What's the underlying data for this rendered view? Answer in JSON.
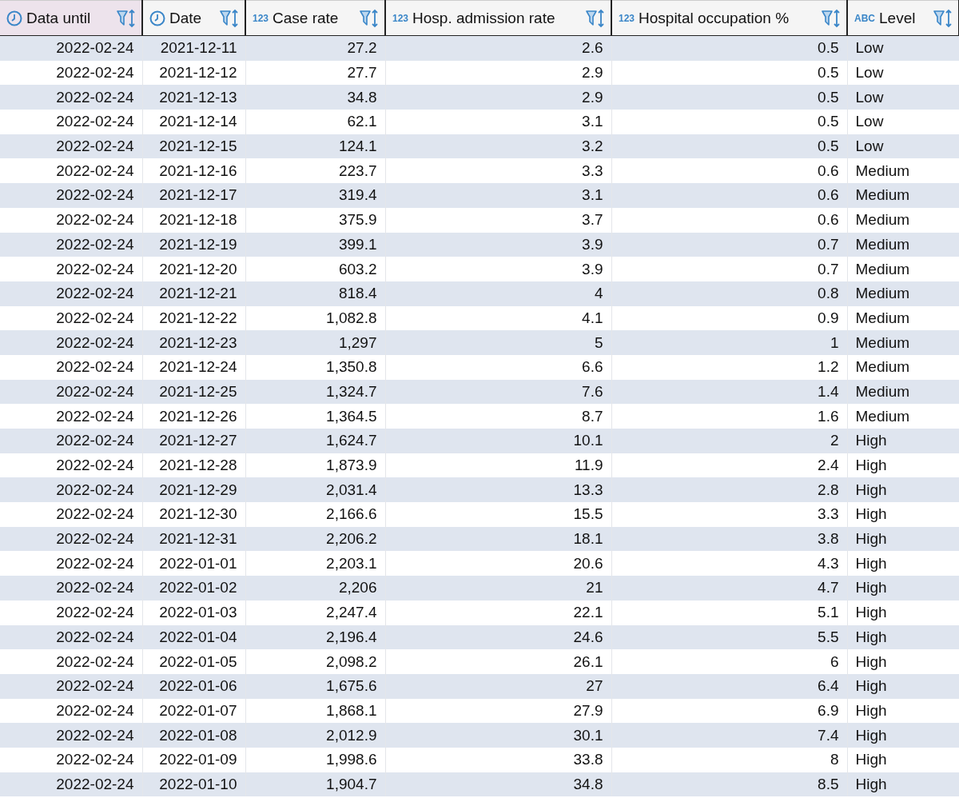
{
  "table": {
    "columns": [
      {
        "label": "Data until",
        "kind": "date",
        "selected": true
      },
      {
        "label": "Date",
        "kind": "date",
        "selected": false
      },
      {
        "label": "Case rate",
        "kind": "number",
        "badge": "123",
        "selected": false
      },
      {
        "label": "Hosp. admission rate",
        "kind": "number",
        "badge": "123",
        "selected": false
      },
      {
        "label": "Hospital occupation %",
        "kind": "number",
        "badge": "123",
        "selected": false
      },
      {
        "label": "Level",
        "kind": "text",
        "badge": "ABC",
        "selected": false
      }
    ],
    "rows": [
      [
        "2022-02-24",
        "2021-12-11",
        "27.2",
        "2.6",
        "0.5",
        "Low"
      ],
      [
        "2022-02-24",
        "2021-12-12",
        "27.7",
        "2.9",
        "0.5",
        "Low"
      ],
      [
        "2022-02-24",
        "2021-12-13",
        "34.8",
        "2.9",
        "0.5",
        "Low"
      ],
      [
        "2022-02-24",
        "2021-12-14",
        "62.1",
        "3.1",
        "0.5",
        "Low"
      ],
      [
        "2022-02-24",
        "2021-12-15",
        "124.1",
        "3.2",
        "0.5",
        "Low"
      ],
      [
        "2022-02-24",
        "2021-12-16",
        "223.7",
        "3.3",
        "0.6",
        "Medium"
      ],
      [
        "2022-02-24",
        "2021-12-17",
        "319.4",
        "3.1",
        "0.6",
        "Medium"
      ],
      [
        "2022-02-24",
        "2021-12-18",
        "375.9",
        "3.7",
        "0.6",
        "Medium"
      ],
      [
        "2022-02-24",
        "2021-12-19",
        "399.1",
        "3.9",
        "0.7",
        "Medium"
      ],
      [
        "2022-02-24",
        "2021-12-20",
        "603.2",
        "3.9",
        "0.7",
        "Medium"
      ],
      [
        "2022-02-24",
        "2021-12-21",
        "818.4",
        "4",
        "0.8",
        "Medium"
      ],
      [
        "2022-02-24",
        "2021-12-22",
        "1,082.8",
        "4.1",
        "0.9",
        "Medium"
      ],
      [
        "2022-02-24",
        "2021-12-23",
        "1,297",
        "5",
        "1",
        "Medium"
      ],
      [
        "2022-02-24",
        "2021-12-24",
        "1,350.8",
        "6.6",
        "1.2",
        "Medium"
      ],
      [
        "2022-02-24",
        "2021-12-25",
        "1,324.7",
        "7.6",
        "1.4",
        "Medium"
      ],
      [
        "2022-02-24",
        "2021-12-26",
        "1,364.5",
        "8.7",
        "1.6",
        "Medium"
      ],
      [
        "2022-02-24",
        "2021-12-27",
        "1,624.7",
        "10.1",
        "2",
        "High"
      ],
      [
        "2022-02-24",
        "2021-12-28",
        "1,873.9",
        "11.9",
        "2.4",
        "High"
      ],
      [
        "2022-02-24",
        "2021-12-29",
        "2,031.4",
        "13.3",
        "2.8",
        "High"
      ],
      [
        "2022-02-24",
        "2021-12-30",
        "2,166.6",
        "15.5",
        "3.3",
        "High"
      ],
      [
        "2022-02-24",
        "2021-12-31",
        "2,206.2",
        "18.1",
        "3.8",
        "High"
      ],
      [
        "2022-02-24",
        "2022-01-01",
        "2,203.1",
        "20.6",
        "4.3",
        "High"
      ],
      [
        "2022-02-24",
        "2022-01-02",
        "2,206",
        "21",
        "4.7",
        "High"
      ],
      [
        "2022-02-24",
        "2022-01-03",
        "2,247.4",
        "22.1",
        "5.1",
        "High"
      ],
      [
        "2022-02-24",
        "2022-01-04",
        "2,196.4",
        "24.6",
        "5.5",
        "High"
      ],
      [
        "2022-02-24",
        "2022-01-05",
        "2,098.2",
        "26.1",
        "6",
        "High"
      ],
      [
        "2022-02-24",
        "2022-01-06",
        "1,675.6",
        "27",
        "6.4",
        "High"
      ],
      [
        "2022-02-24",
        "2022-01-07",
        "1,868.1",
        "27.9",
        "6.9",
        "High"
      ],
      [
        "2022-02-24",
        "2022-01-08",
        "2,012.9",
        "30.1",
        "7.4",
        "High"
      ],
      [
        "2022-02-24",
        "2022-01-09",
        "1,998.6",
        "33.8",
        "8",
        "High"
      ],
      [
        "2022-02-24",
        "2022-01-10",
        "1,904.7",
        "34.8",
        "8.5",
        "High"
      ]
    ]
  }
}
